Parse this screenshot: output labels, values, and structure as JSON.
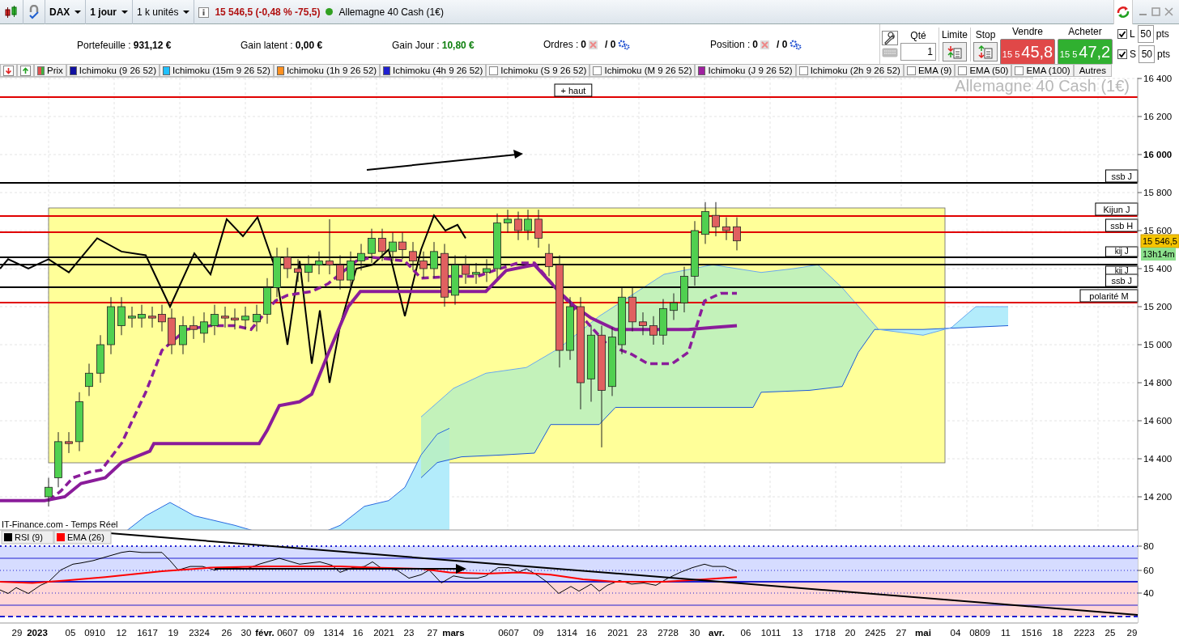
{
  "toolbar": {
    "symbol": "DAX",
    "period": "1 jour",
    "size": "1 k unités",
    "quote": "15 546,5 (-0,48 % -75,5)",
    "instrument": "Allemagne 40 Cash (1€)"
  },
  "summary": [
    {
      "label": "Portefeuille :",
      "value": "931,12 €",
      "kind": "plain"
    },
    {
      "label": "Gain latent :",
      "value": "0,00 €",
      "kind": "plain"
    },
    {
      "label": "Gain Jour :",
      "value": "10,80 €",
      "kind": "gain"
    }
  ],
  "counters": [
    {
      "label": "Ordres :",
      "count": "0",
      "pending": "/ 0"
    },
    {
      "label": "Position :",
      "count": "0",
      "pending": "/ 0"
    }
  ],
  "order_panel": {
    "qty_label": "Qté",
    "qty": "1",
    "limit_label": "Limite",
    "stop_label": "Stop",
    "sell": {
      "label": "Vendre",
      "prefix": "15 5",
      "price": "45,8"
    },
    "buy": {
      "label": "Acheter",
      "prefix": "15 5",
      "price": "47,2"
    },
    "distances": [
      {
        "label": "L",
        "checked": true,
        "value": "50",
        "unit": "pts"
      },
      {
        "label": "S",
        "checked": true,
        "value": "50",
        "unit": "pts"
      }
    ]
  },
  "indicators": [
    {
      "label": "Prix",
      "kind": "price",
      "checked": true
    },
    {
      "label": "Ichimoku (9 26 52)",
      "kind": "ichimoku",
      "checked": true,
      "color": "#1010a0"
    },
    {
      "label": "Ichimoku (15m 9 26 52)",
      "kind": "ichimoku",
      "checked": true,
      "color": "#20c0ff"
    },
    {
      "label": "Ichimoku (1h 9 26 52)",
      "kind": "ichimoku",
      "checked": true,
      "color": "#ff9020"
    },
    {
      "label": "Ichimoku (4h 9 26 52)",
      "kind": "ichimoku",
      "checked": true,
      "color": "#2020d0"
    },
    {
      "label": "Ichimoku (S 9 26 52)",
      "kind": "ichimoku",
      "checked": false
    },
    {
      "label": "Ichimoku (M 9 26 52)",
      "kind": "ichimoku",
      "checked": false
    },
    {
      "label": "Ichimoku (J 9 26 52)",
      "kind": "ichimoku",
      "checked": true,
      "color": "#a020a0"
    },
    {
      "label": "Ichimoku (2h 9 26 52)",
      "kind": "ichimoku",
      "checked": false
    },
    {
      "label": "EMA (9)",
      "kind": "ema",
      "checked": false
    },
    {
      "label": "EMA (50)",
      "kind": "ema",
      "checked": false
    },
    {
      "label": "EMA (100)",
      "kind": "ema",
      "checked": false
    }
  ],
  "more_label": "Autres",
  "chart": {
    "instrument_label": "Allemagne 40 Cash (1€)",
    "price_ticks": [
      {
        "label": "16 400",
        "bold": false
      },
      {
        "label": "16 200",
        "bold": false
      },
      {
        "label": "16 000",
        "bold": true
      },
      {
        "label": "15 800",
        "bold": false
      },
      {
        "label": "15 600",
        "bold": false
      },
      {
        "label": "15 400",
        "bold": false
      },
      {
        "label": "15 200",
        "bold": false
      },
      {
        "label": "15 000",
        "bold": false
      },
      {
        "label": "14 800",
        "bold": false
      },
      {
        "label": "14 600",
        "bold": false
      },
      {
        "label": "14 400",
        "bold": false
      },
      {
        "label": "14 200",
        "bold": false
      }
    ],
    "levels": [
      {
        "label": "+ haut",
        "color": "#e00000"
      },
      {
        "label": "ssb J",
        "color": "#000000"
      },
      {
        "label": "Kijun J",
        "color": "#e00000"
      },
      {
        "label": "ssb H",
        "color": "#e00000"
      },
      {
        "label": "kij J",
        "color": "#000000"
      },
      {
        "label": "kij J",
        "color": "#000000"
      },
      {
        "label": "ssb J",
        "color": "#000000"
      },
      {
        "label": "polarité M",
        "color": "#e00000"
      }
    ],
    "price_tag": "15 546,5",
    "countdown": "13h14m"
  },
  "rsi": {
    "source": "IT-Finance.com - Temps Réel",
    "legend": [
      {
        "label": "RSI (9)",
        "color": "#000000"
      },
      {
        "label": "EMA (26)",
        "color": "#ff0000"
      }
    ],
    "ticks": [
      "80",
      "60",
      "40"
    ]
  },
  "dates": [
    {
      "label": "29",
      "kind": "day"
    },
    {
      "label": "2023",
      "kind": "month"
    },
    {
      "label": "05",
      "kind": "day"
    },
    {
      "label": "0910",
      "kind": "day"
    },
    {
      "label": "12",
      "kind": "day"
    },
    {
      "label": "1617",
      "kind": "day"
    },
    {
      "label": "19",
      "kind": "day"
    },
    {
      "label": "2324",
      "kind": "day"
    },
    {
      "label": "26",
      "kind": "day"
    },
    {
      "label": "30",
      "kind": "day"
    },
    {
      "label": "févr.",
      "kind": "month"
    },
    {
      "label": "0607",
      "kind": "day"
    },
    {
      "label": "09",
      "kind": "day"
    },
    {
      "label": "1314",
      "kind": "day"
    },
    {
      "label": "16",
      "kind": "day"
    },
    {
      "label": "2021",
      "kind": "day"
    },
    {
      "label": "23",
      "kind": "day"
    },
    {
      "label": "27",
      "kind": "day"
    },
    {
      "label": "mars",
      "kind": "month"
    },
    {
      "label": "0607",
      "kind": "day"
    },
    {
      "label": "09",
      "kind": "day"
    },
    {
      "label": "1314",
      "kind": "day"
    },
    {
      "label": "16",
      "kind": "day"
    },
    {
      "label": "2021",
      "kind": "day"
    },
    {
      "label": "23",
      "kind": "day"
    },
    {
      "label": "2728",
      "kind": "day"
    },
    {
      "label": "30",
      "kind": "day"
    },
    {
      "label": "avr.",
      "kind": "month"
    },
    {
      "label": "06",
      "kind": "day"
    },
    {
      "label": "1011",
      "kind": "day"
    },
    {
      "label": "13",
      "kind": "day"
    },
    {
      "label": "1718",
      "kind": "day"
    },
    {
      "label": "20",
      "kind": "day"
    },
    {
      "label": "2425",
      "kind": "day"
    },
    {
      "label": "27",
      "kind": "day"
    },
    {
      "label": "mai",
      "kind": "month"
    },
    {
      "label": "04",
      "kind": "day"
    },
    {
      "label": "0809",
      "kind": "day"
    },
    {
      "label": "11",
      "kind": "day"
    },
    {
      "label": "1516",
      "kind": "day"
    },
    {
      "label": "18",
      "kind": "day"
    },
    {
      "label": "2223",
      "kind": "day"
    },
    {
      "label": "25",
      "kind": "day"
    },
    {
      "label": "29",
      "kind": "day"
    }
  ]
}
